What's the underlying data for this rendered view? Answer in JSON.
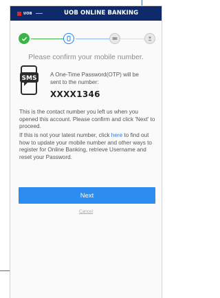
{
  "header": {
    "logo_text": "UOB",
    "title": "UOB ONLINE BANKING"
  },
  "stepper": {
    "steps": [
      {
        "state": "done",
        "icon": "check-icon"
      },
      {
        "state": "active",
        "icon": "phone-icon"
      },
      {
        "state": "todo",
        "icon": "card-icon"
      },
      {
        "state": "todo",
        "icon": "person-icon"
      }
    ]
  },
  "prompt": "Please confirm your mobile number.",
  "otp": {
    "icon_label": "SMS",
    "line1": "A One-Time Password(OTP) will be",
    "line2": "sent to the number:",
    "number": "XXXX1346"
  },
  "para1": "This is the contact number you left us when you opened this account. Please confirm and click 'Next' to proceed.",
  "para2": {
    "before": "If this is not your latest number, click ",
    "link": "here",
    "after": " to find out how to update your mobile number and other ways to register for Online Banking, retrieve Username and reset your Password."
  },
  "buttons": {
    "next": "Next",
    "cancel": "Cancel"
  },
  "colors": {
    "header_bg": "#0f2a6b",
    "accent": "#2d8cf0",
    "done": "#3bb54a"
  }
}
